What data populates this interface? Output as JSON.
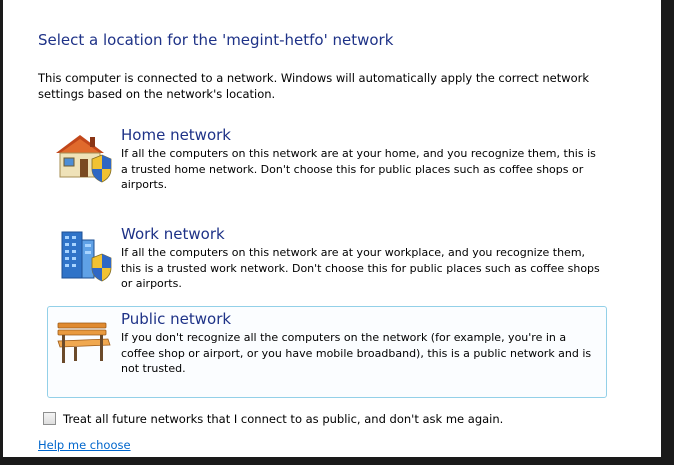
{
  "dialog": {
    "heading": "Select a location for the 'megint-hetfo' network",
    "intro": "This computer is connected to a network. Windows will automatically apply the correct network settings based on the network's location."
  },
  "options": [
    {
      "title": "Home network",
      "description": "If all the computers on this network are at your home, and you recognize them, this is a trusted home network.  Don't choose this for public places such as coffee shops or airports.",
      "icon": "home-network-icon"
    },
    {
      "title": "Work network",
      "description": "If all the computers on this network are at your workplace, and you recognize them, this is a trusted work network.  Don't choose this for public places such as coffee shops or airports.",
      "icon": "work-network-icon"
    },
    {
      "title": "Public network",
      "description": "If you don't recognize all the computers on the network (for example, you're in a coffee shop or airport, or you have mobile broadband), this is a public network and is not trusted.",
      "icon": "public-network-bench-icon"
    }
  ],
  "checkbox": {
    "label": "Treat all future networks that I connect to as public, and don't ask me again.",
    "checked": false
  },
  "help_link": "Help me choose",
  "colors": {
    "heading": "#1e3287",
    "link": "#0066cc",
    "selected_border": "#93d0e8"
  }
}
